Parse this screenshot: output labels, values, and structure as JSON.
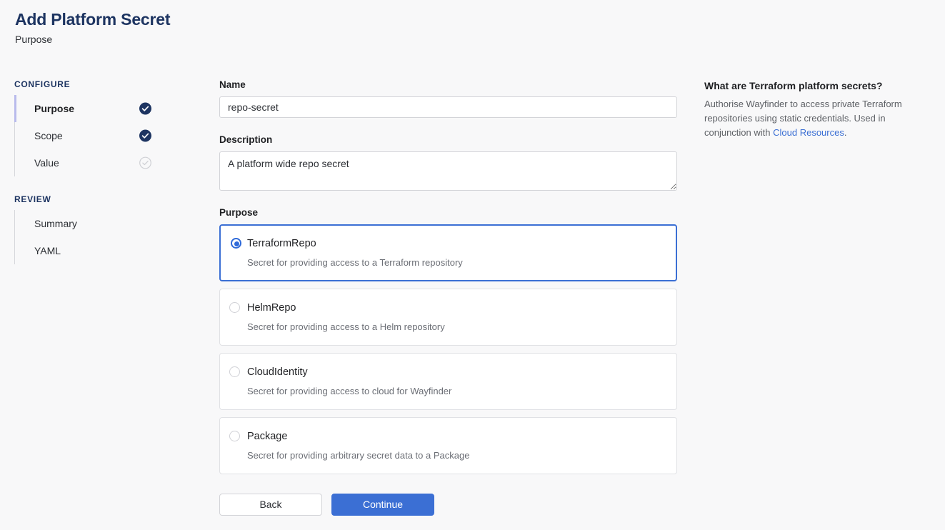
{
  "header": {
    "title": "Add Platform Secret",
    "subtitle": "Purpose"
  },
  "sidebar": {
    "groups": [
      {
        "title": "CONFIGURE",
        "items": [
          {
            "label": "Purpose",
            "state": "complete",
            "active": true
          },
          {
            "label": "Scope",
            "state": "complete",
            "active": false
          },
          {
            "label": "Value",
            "state": "pending",
            "active": false
          }
        ]
      },
      {
        "title": "REVIEW",
        "items": [
          {
            "label": "Summary",
            "state": "none",
            "active": false
          },
          {
            "label": "YAML",
            "state": "none",
            "active": false
          }
        ]
      }
    ]
  },
  "form": {
    "name": {
      "label": "Name",
      "value": "repo-secret",
      "placeholder": ""
    },
    "description": {
      "label": "Description",
      "value": "A platform wide repo secret",
      "placeholder": ""
    },
    "purpose": {
      "label": "Purpose",
      "selected": "TerraformRepo",
      "options": [
        {
          "title": "TerraformRepo",
          "description": "Secret for providing access to a Terraform repository",
          "selected": true
        },
        {
          "title": "HelmRepo",
          "description": "Secret for providing access to a Helm repository",
          "selected": false
        },
        {
          "title": "CloudIdentity",
          "description": "Secret for providing access to cloud for Wayfinder",
          "selected": false
        },
        {
          "title": "Package",
          "description": "Secret for providing arbitrary secret data to a Package",
          "selected": false
        }
      ]
    }
  },
  "actions": {
    "back_label": "Back",
    "continue_label": "Continue"
  },
  "help": {
    "title": "What are Terraform platform secrets?",
    "body_before": "Authorise Wayfinder to access private Terraform repositories using static credentials. Used in conjunction with ",
    "link_text": "Cloud Resources",
    "body_after": "."
  },
  "colors": {
    "accent_blue": "#3b6fd4",
    "navy": "#1d3461",
    "active_rail": "#b9bbec",
    "link": "#3b6fd4"
  }
}
